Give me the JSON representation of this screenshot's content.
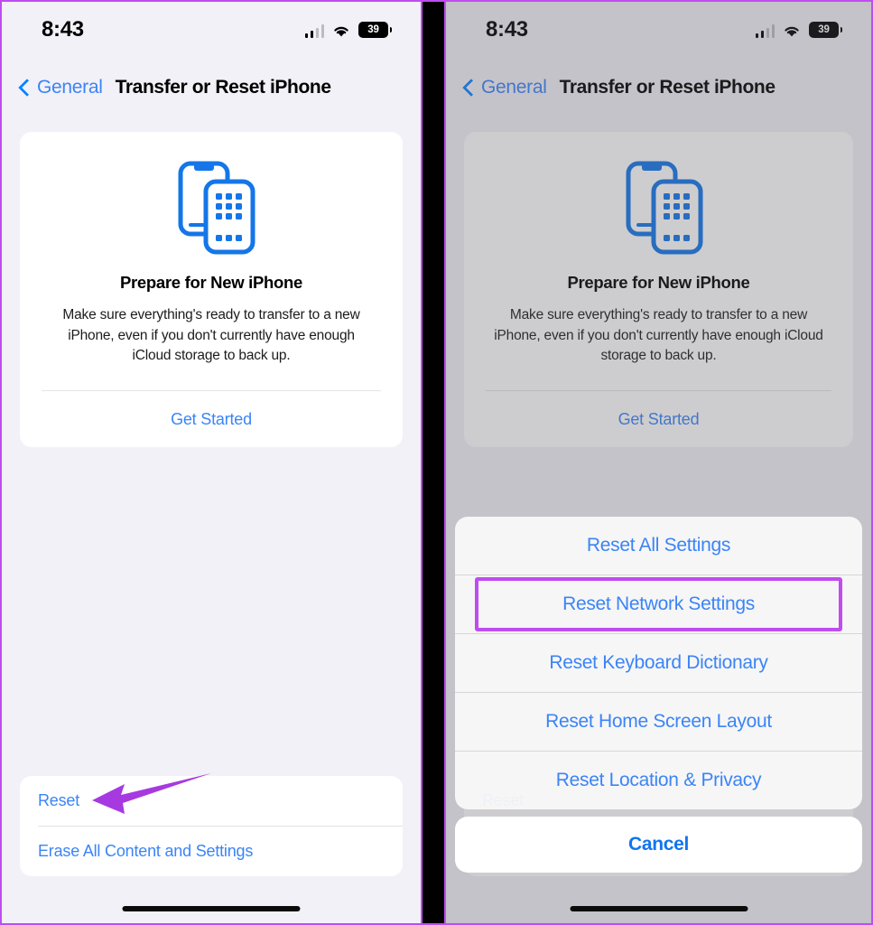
{
  "meta": {
    "accent_blue": "#3b84f7",
    "highlight_purple": "#c04cf0",
    "screen_bg": "#f2f1f7"
  },
  "status_bar": {
    "time": "8:43",
    "battery_level": "39",
    "signal_icon": "cellular-bars-icon",
    "wifi_icon": "wifi-icon",
    "battery_icon": "battery-icon"
  },
  "nav": {
    "back_icon": "chevron-left-icon",
    "back_label": "General",
    "title": "Transfer or Reset iPhone"
  },
  "card": {
    "illustration_icon": "two-iphones-transfer-icon",
    "title": "Prepare for New iPhone",
    "description": "Make sure everything's ready to transfer to a new iPhone, even if you don't currently have enough iCloud storage to back up.",
    "action_label": "Get Started"
  },
  "bottom_list": {
    "items": [
      {
        "label": "Reset"
      },
      {
        "label": "Erase All Content and Settings"
      }
    ]
  },
  "annotations": {
    "arrow": {
      "name": "purple-arrow-pointing-to-reset",
      "color": "#a739e0"
    },
    "highlight_box": {
      "name": "purple-highlight-reset-network-settings",
      "color": "#c04cf0"
    }
  },
  "action_sheet": {
    "items": [
      {
        "label": "Reset All Settings",
        "highlighted": false
      },
      {
        "label": "Reset Network Settings",
        "highlighted": true
      },
      {
        "label": "Reset Keyboard Dictionary",
        "highlighted": false
      },
      {
        "label": "Reset Home Screen Layout",
        "highlighted": false
      },
      {
        "label": "Reset Location & Privacy",
        "highlighted": false
      }
    ],
    "cancel_label": "Cancel"
  }
}
